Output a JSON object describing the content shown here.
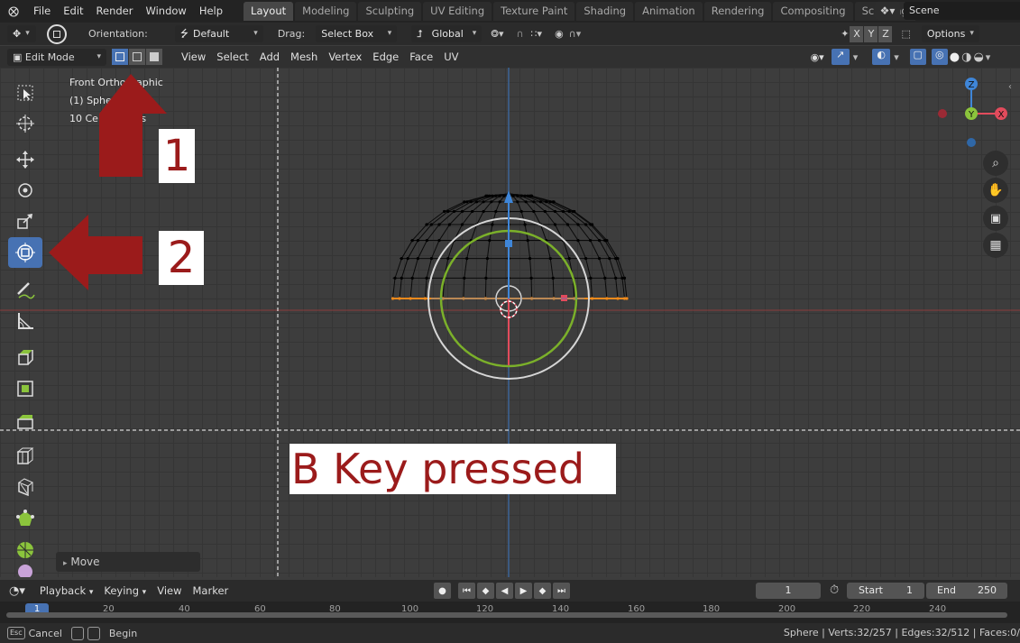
{
  "topbar": {
    "menus": [
      "File",
      "Edit",
      "Render",
      "Window",
      "Help"
    ],
    "workspaces": [
      "Layout",
      "Modeling",
      "Sculpting",
      "UV Editing",
      "Texture Paint",
      "Shading",
      "Animation",
      "Rendering",
      "Compositing",
      "Scripting"
    ],
    "active_workspace": "Layout",
    "scene": "Scene"
  },
  "tool_header": {
    "orientation_label": "Orientation:",
    "orientation_value": "Default",
    "drag_label": "Drag:",
    "drag_value": "Select Box",
    "transform_orientation": "Global",
    "axes": [
      "X",
      "Y",
      "Z"
    ],
    "options_label": "Options"
  },
  "viewport_header": {
    "mode": "Edit Mode",
    "menus": [
      "View",
      "Select",
      "Add",
      "Mesh",
      "Vertex",
      "Edge",
      "Face",
      "UV"
    ]
  },
  "viewport": {
    "view_name": "Front Orthographic",
    "object_line": "(1) Sphere",
    "scale_line": "10 Centimeters",
    "gizmo_axes": {
      "z": "Z",
      "y": "Y",
      "x": "X"
    },
    "last_op_panel": "Move"
  },
  "annotations": {
    "callout_1": "1",
    "callout_2": "2",
    "banner": "B Key pressed"
  },
  "colors": {
    "accent": "#4772b3",
    "annotation_red": "#9b1b1b",
    "axis_x": "#e24b5c",
    "axis_y": "#8bc43c",
    "axis_z": "#3f86d8"
  },
  "timeline": {
    "menus": [
      "Playback",
      "Keying",
      "View",
      "Marker"
    ],
    "current_frame": "1",
    "start_label": "Start",
    "start_value": "1",
    "end_label": "End",
    "end_value": "250",
    "ruler_ticks": [
      "1",
      "20",
      "40",
      "60",
      "80",
      "100",
      "120",
      "140",
      "160",
      "180",
      "200",
      "220",
      "240"
    ]
  },
  "statusbar": {
    "esc_key": "Esc",
    "cancel": "Cancel",
    "begin": "Begin",
    "stats": "Sphere | Verts:32/257 | Edges:32/512 | Faces:0/"
  }
}
